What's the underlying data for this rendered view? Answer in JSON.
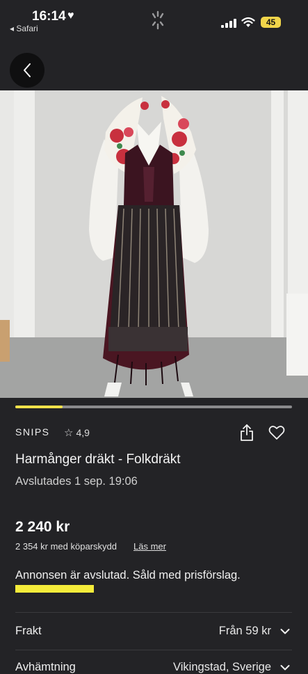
{
  "status_bar": {
    "time": "16:14",
    "back_app": "◂ Safari",
    "battery": "45"
  },
  "colors": {
    "background": "#232326",
    "accent_yellow": "#f0e14a",
    "highlight_yellow": "#f5ec3a"
  },
  "gallery": {
    "progress_fraction": 0.17
  },
  "seller": {
    "name": "SNIPS",
    "rating": "4,9"
  },
  "listing": {
    "title": "Harmånger dräkt - Folkdräkt",
    "ended": "Avslutades 1 sep. 19:06",
    "price": "2 240 kr",
    "buyer_protection_price": "2 354 kr med köparskydd",
    "read_more": "Läs mer",
    "status_message": "Annonsen är avslutad. Såld med prisförslag."
  },
  "details": [
    {
      "label": "Frakt",
      "value": "Från 59 kr"
    },
    {
      "label": "Avhämtning",
      "value": "Vikingstad, Sverige"
    }
  ],
  "icons": {
    "back": "back-arrow-icon",
    "share": "share-icon",
    "favorite": "heart-icon",
    "rating": "star-icon",
    "expand": "chevron-down-icon"
  }
}
